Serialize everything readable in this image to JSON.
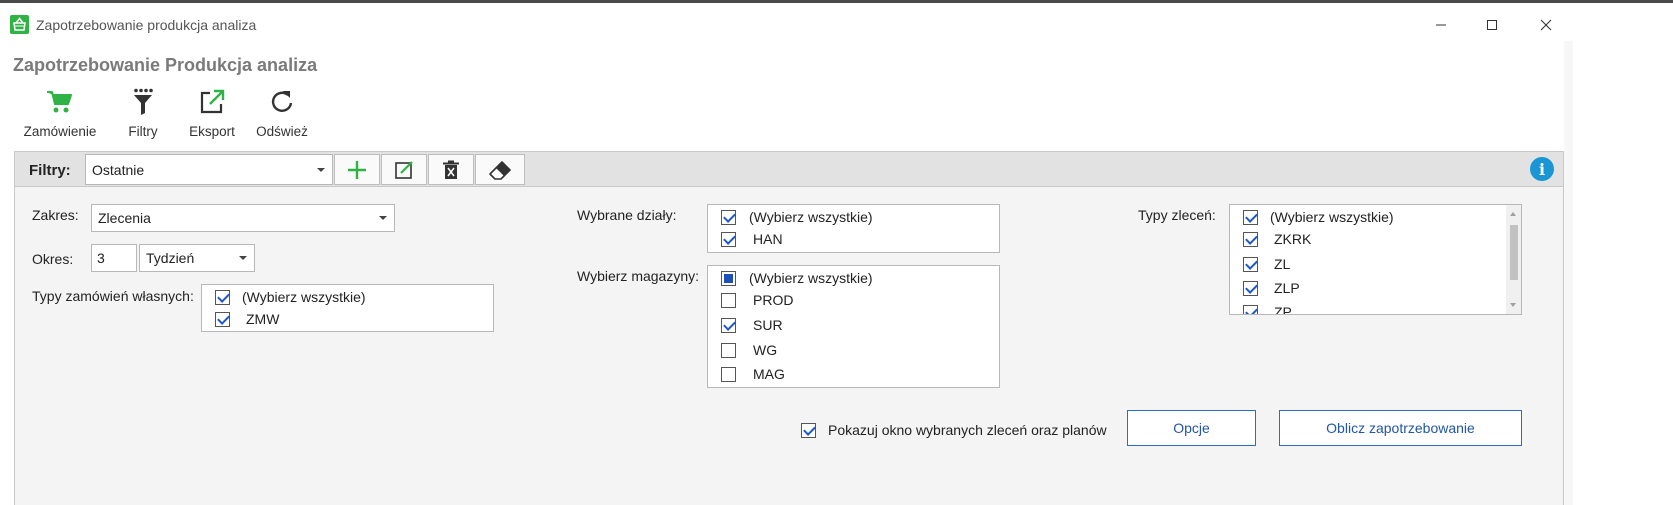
{
  "window": {
    "title": "Zapotrzebowanie produkcja analiza"
  },
  "page_title": "Zapotrzebowanie Produkcja analiza",
  "toolbar": {
    "order_label": "Zamówienie",
    "filters_label": "Filtry",
    "export_label": "Eksport",
    "refresh_label": "Odśwież"
  },
  "filterbar": {
    "label": "Filtry:",
    "selected": "Ostatnie"
  },
  "form": {
    "zakres": {
      "label": "Zakres:",
      "value": "Zlecenia"
    },
    "okres": {
      "label": "Okres:",
      "number": "3",
      "unit": "Tydzień"
    },
    "typy_zamowien": {
      "label": "Typy zamówień własnych:",
      "items": [
        {
          "label": "(Wybierz wszystkie)",
          "state": "checked"
        },
        {
          "label": "ZMW",
          "state": "checked"
        }
      ]
    },
    "dzialy": {
      "label": "Wybrane działy:",
      "items": [
        {
          "label": "(Wybierz wszystkie)",
          "state": "checked"
        },
        {
          "label": "HAN",
          "state": "checked"
        }
      ]
    },
    "magazyny": {
      "label": "Wybierz magazyny:",
      "items": [
        {
          "label": "(Wybierz wszystkie)",
          "state": "partial"
        },
        {
          "label": "PROD",
          "state": "unchecked"
        },
        {
          "label": "SUR",
          "state": "checked"
        },
        {
          "label": "WG",
          "state": "unchecked"
        },
        {
          "label": "MAG",
          "state": "unchecked"
        }
      ]
    },
    "typy_zlecen": {
      "label": "Typy zleceń:",
      "items": [
        {
          "label": "(Wybierz wszystkie)",
          "state": "checked"
        },
        {
          "label": "ZKRK",
          "state": "checked"
        },
        {
          "label": "ZL",
          "state": "checked"
        },
        {
          "label": "ZLP",
          "state": "checked"
        },
        {
          "label": "ZP",
          "state": "checked"
        }
      ]
    },
    "pokazuj": {
      "label": "Pokazuj okno wybranych zleceń oraz planów",
      "state": "checked"
    }
  },
  "actions": {
    "opcje_label": "Opcje",
    "oblicz_label": "Oblicz zapotrzebowanie"
  },
  "colors": {
    "accent": "#2fb344",
    "button_border": "#2b6bc9",
    "check": "#1e58c8",
    "info": "#1a96d4"
  },
  "icons": {
    "app": "basket-icon",
    "order": "cart-icon",
    "filters": "funnel-icon",
    "export": "external-link-icon",
    "refresh": "refresh-icon",
    "add": "plus-icon",
    "edit": "edit-icon",
    "delete": "trash-icon",
    "clear": "eraser-icon",
    "info": "info-icon"
  }
}
